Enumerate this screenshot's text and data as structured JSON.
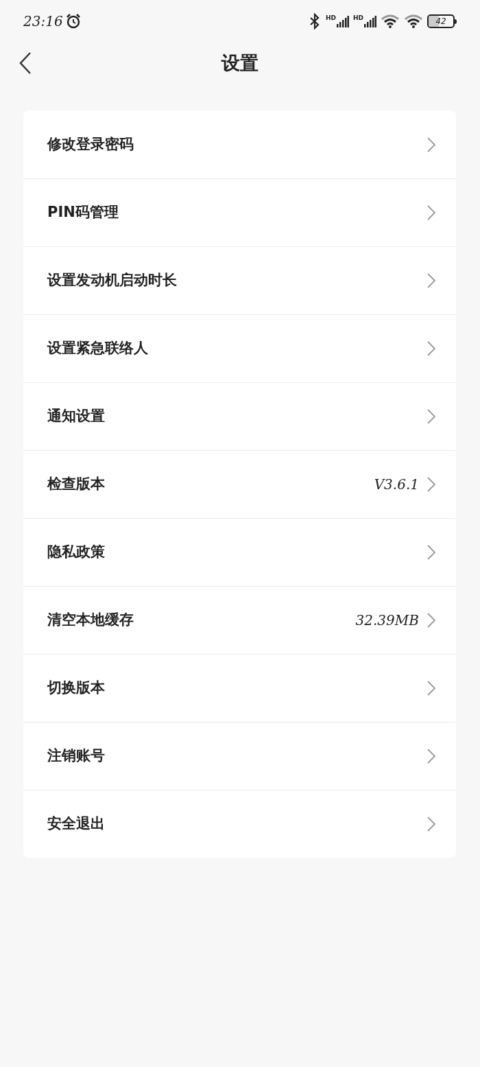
{
  "status_bar": {
    "time": "23:16",
    "signal_labels": [
      "HD",
      "HD"
    ],
    "battery": "42"
  },
  "header": {
    "title": "设置"
  },
  "settings": [
    {
      "label": "修改登录密码"
    },
    {
      "label": "PIN码管理"
    },
    {
      "label": "设置发动机启动时长"
    },
    {
      "label": "设置紧急联络人"
    },
    {
      "label": "通知设置"
    },
    {
      "label": "检查版本",
      "value": "V3.6.1"
    },
    {
      "label": "隐私政策"
    },
    {
      "label": "清空本地缓存",
      "value": "32.39MB"
    },
    {
      "label": "切换版本"
    },
    {
      "label": "注销账号"
    },
    {
      "label": "安全退出"
    }
  ]
}
